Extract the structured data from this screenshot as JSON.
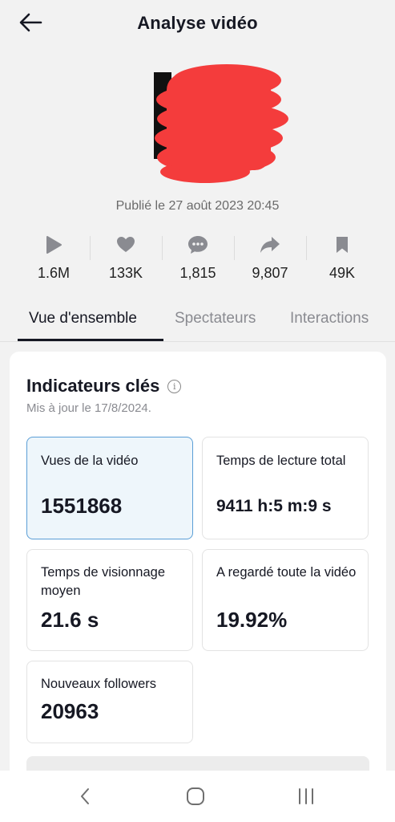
{
  "header": {
    "title": "Analyse vidéo",
    "back_icon": "arrow-left-icon"
  },
  "video": {
    "published": "Publié le 27 août 2023 20:45",
    "redaction_color": "#f43c3c"
  },
  "stats": [
    {
      "icon": "play-icon",
      "value": "1.6M"
    },
    {
      "icon": "heart-icon",
      "value": "133K"
    },
    {
      "icon": "comment-icon",
      "value": "1,815"
    },
    {
      "icon": "share-icon",
      "value": "9,807"
    },
    {
      "icon": "bookmark-icon",
      "value": "49K"
    }
  ],
  "tabs": [
    {
      "label": "Vue d'ensemble",
      "active": true
    },
    {
      "label": "Spectateurs",
      "active": false
    },
    {
      "label": "Interactions",
      "active": false
    }
  ],
  "key_metrics": {
    "title": "Indicateurs clés",
    "updated": "Mis à jour le 17/8/2024.",
    "items": [
      {
        "label": "Vues de la vidéo",
        "value": "1551868",
        "selected": true
      },
      {
        "label": "Temps de lecture total",
        "value": "9411 h:5 m:9 s",
        "selected": false
      },
      {
        "label": "Temps de visionnage moyen",
        "value": "21.6 s",
        "selected": false
      },
      {
        "label": "A regardé toute la vidéo",
        "value": "19.92%",
        "selected": false
      },
      {
        "label": "Nouveaux followers",
        "value": "20963",
        "selected": false
      }
    ]
  },
  "system_nav": {
    "back_icon": "nav-back-icon",
    "home_icon": "nav-home-icon",
    "recents_icon": "nav-recents-icon"
  },
  "colors": {
    "background": "#f2f2f2",
    "card": "#ffffff",
    "selected_card_bg": "#eef6fb",
    "selected_card_border": "#5a9ed6",
    "text_primary": "#161823",
    "text_secondary": "#8a8b91"
  }
}
